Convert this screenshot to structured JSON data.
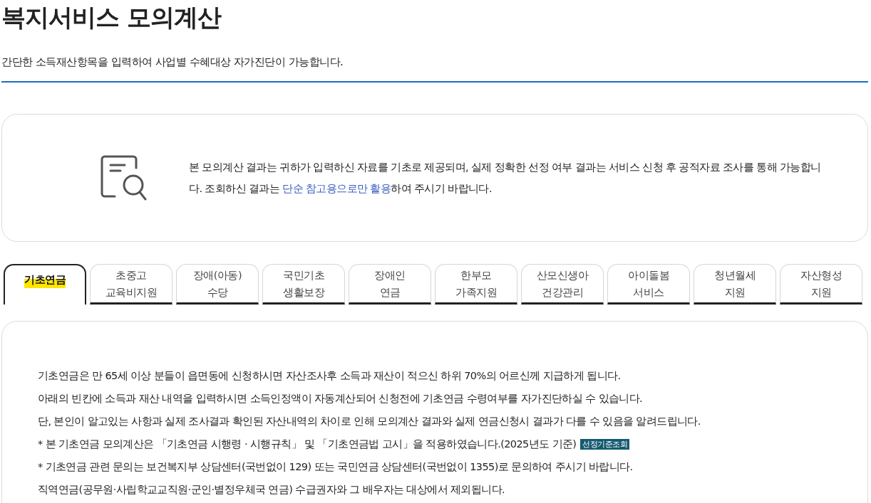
{
  "title": "복지서비스 모의계산",
  "subtitle": "간단한 소득재산항목을 입력하여 사업별 수혜대상 자가진단이 가능합니다.",
  "notice": {
    "text_before": "본 모의계산 결과는 귀하가 입력하신 자료를 기초로 제공되며, 실제 정확한 선정 여부 결과는 서비스 신청 후 공적자료 조사를 통해 가능합니다. 조회하신 결과는 ",
    "emphasis": "단순 참고용으로만 활용",
    "text_after": "하여 주시기 바랍니다."
  },
  "tabs": [
    {
      "lines": [
        "기초연금"
      ],
      "selected": true
    },
    {
      "lines": [
        "초중고",
        "교육비지원"
      ],
      "selected": false
    },
    {
      "lines": [
        "장애(아동)",
        "수당"
      ],
      "selected": false
    },
    {
      "lines": [
        "국민기초",
        "생활보장"
      ],
      "selected": false
    },
    {
      "lines": [
        "장애인",
        "연금"
      ],
      "selected": false
    },
    {
      "lines": [
        "한부모",
        "가족지원"
      ],
      "selected": false
    },
    {
      "lines": [
        "산모신생아",
        "건강관리"
      ],
      "selected": false
    },
    {
      "lines": [
        "아이돌봄",
        "서비스"
      ],
      "selected": false
    },
    {
      "lines": [
        "청년월세",
        "지원"
      ],
      "selected": false
    },
    {
      "lines": [
        "자산형성",
        "지원"
      ],
      "selected": false
    }
  ],
  "content": [
    {
      "text": "기초연금은 만 65세 이상 분들이 읍면동에 신청하시면 자산조사후 소득과 재산이 적으신 하위 70%의 어르신께 지급하게 됩니다."
    },
    {
      "text": "아래의 빈칸에 소득과 재산 내역을 입력하시면 소득인정액이 자동계산되어 신청전에 기초연금 수령여부를 자가진단하실 수 있습니다."
    },
    {
      "text": "단, 본인이 알고있는 사항과 실제 조사결과 확인된 자산내역의 차이로 인해 모의계산 결과와 실제 연금신청시 결과가 다를 수 있음을 알려드립니다."
    },
    {
      "text": "* 본 기초연금 모의계산은 「기초연금 시행령 · 시행규칙」 및 「기초연금법 고시」을 적용하였습니다.(2025년도 기준)",
      "button": "선정기준조회"
    },
    {
      "text": "* 기초연금 관련 문의는 보건복지부 상담센터(국번없이 129) 또는 국민연금 상담센터(국번없이 1355)로 문의하여 주시기 바랍니다."
    },
    {
      "text": "직역연금(공무원·사립학교교직원·군인·별정우체국 연금) 수급권자와 그 배우자는 대상에서 제외됩니다."
    }
  ]
}
